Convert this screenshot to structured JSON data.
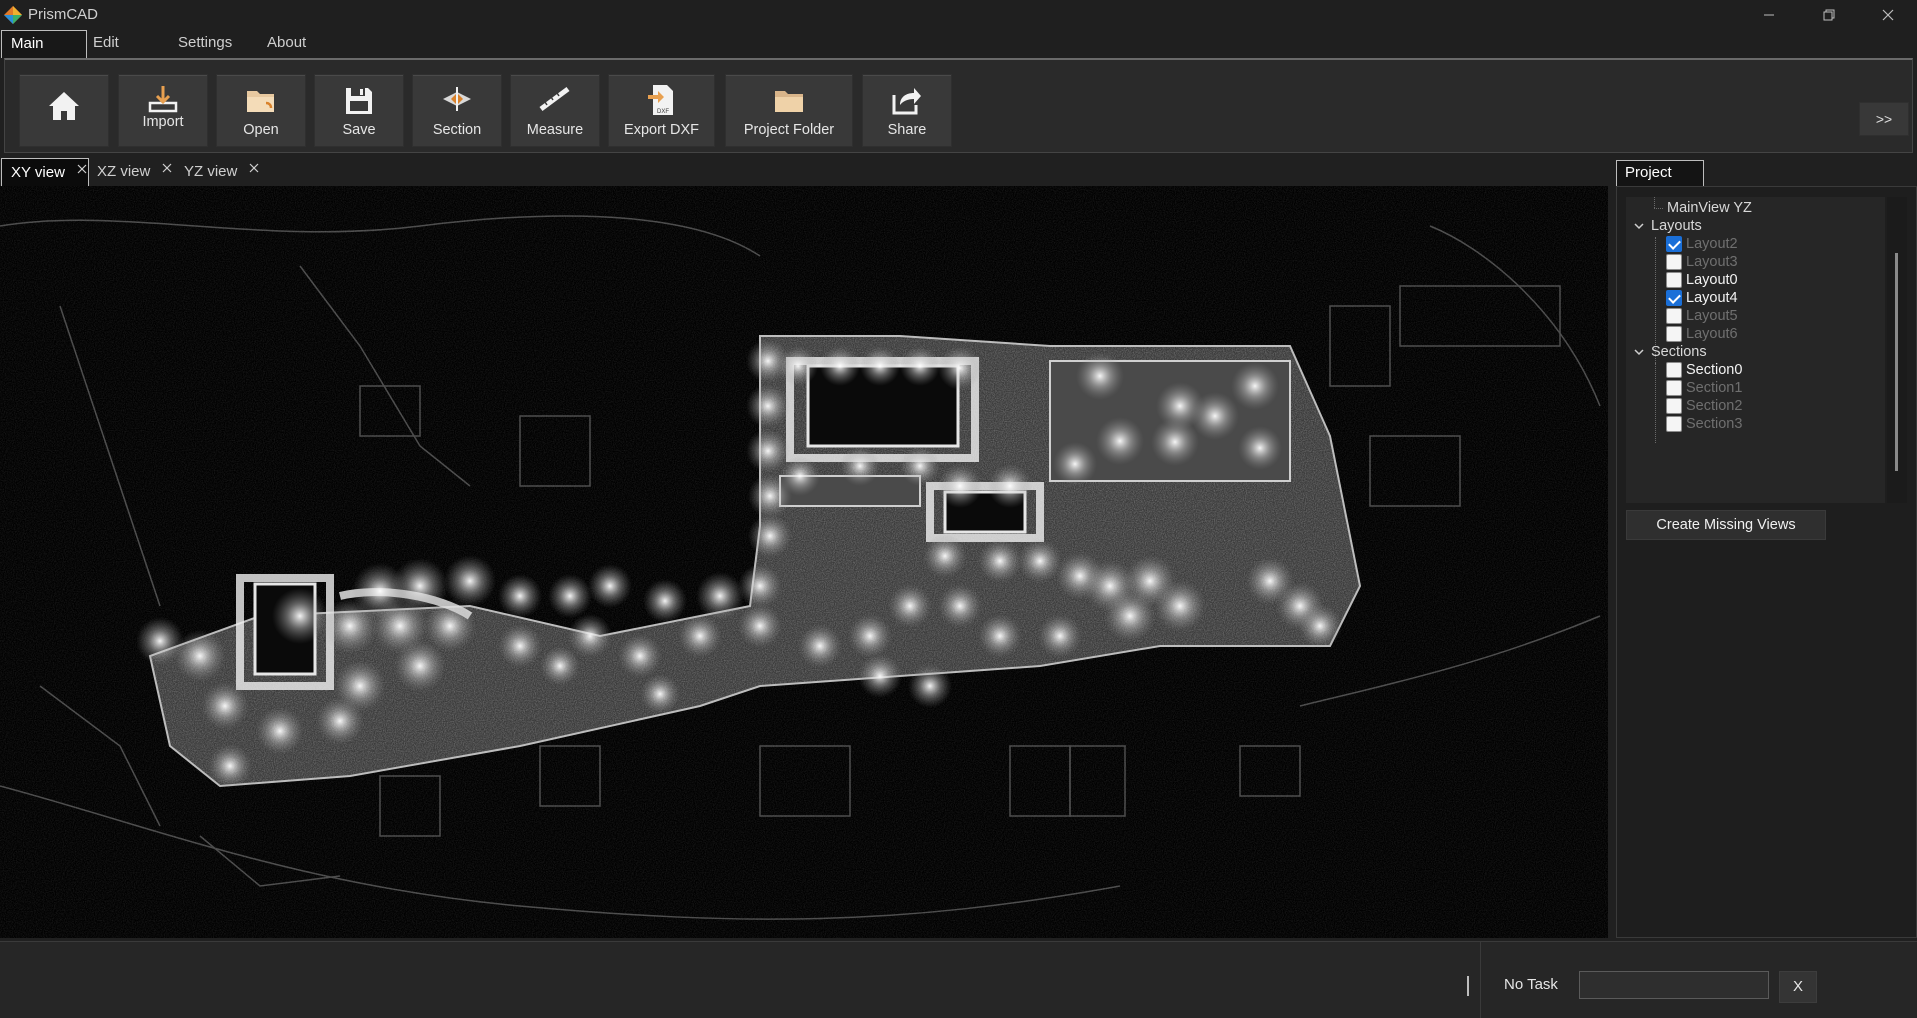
{
  "app": {
    "title": "PrismCAD",
    "logo_icon": "prismcad-logo-icon"
  },
  "window_controls": {
    "minimize": "minimize-icon",
    "restore": "restore-icon",
    "close": "close-icon"
  },
  "menu": {
    "tabs": [
      "Main",
      "Edit",
      "Settings",
      "About"
    ],
    "active": "Main"
  },
  "ribbon": {
    "buttons": [
      {
        "label": "",
        "icon": "home-icon"
      },
      {
        "label": "Import",
        "icon": "import-icon"
      },
      {
        "label": "Open",
        "icon": "folder-open-icon"
      },
      {
        "label": "Save",
        "icon": "save-icon"
      },
      {
        "label": "Section",
        "icon": "section-icon"
      },
      {
        "label": "Measure",
        "icon": "measure-icon"
      },
      {
        "label": "Export DXF",
        "icon": "export-dxf-icon",
        "badge": "DXF"
      },
      {
        "label": "Project Folder",
        "icon": "project-folder-icon"
      },
      {
        "label": "Share",
        "icon": "share-icon"
      }
    ],
    "more_label": ">>"
  },
  "view_tabs": {
    "tabs": [
      "XY view",
      "XZ view",
      "YZ view"
    ],
    "active": "XY view"
  },
  "project_panel": {
    "tab_label": "Project",
    "tree": {
      "top_item": "MainView YZ",
      "layouts_label": "Layouts",
      "layouts": [
        {
          "label": "Layout2",
          "checked": true,
          "dimmed": true
        },
        {
          "label": "Layout3",
          "checked": false,
          "dimmed": true
        },
        {
          "label": "Layout0",
          "checked": false,
          "dimmed": false
        },
        {
          "label": "Layout4",
          "checked": true,
          "dimmed": false
        },
        {
          "label": "Layout5",
          "checked": false,
          "dimmed": true
        },
        {
          "label": "Layout6",
          "checked": false,
          "dimmed": true
        }
      ],
      "sections_label": "Sections",
      "sections": [
        {
          "label": "Section0",
          "checked": false,
          "dimmed": false
        },
        {
          "label": "Section1",
          "checked": false,
          "dimmed": true
        },
        {
          "label": "Section2",
          "checked": false,
          "dimmed": true
        },
        {
          "label": "Section3",
          "checked": false,
          "dimmed": true
        }
      ]
    },
    "create_button": "Create Missing Views"
  },
  "status": {
    "task_label": "No Task",
    "task_value": "",
    "cancel_label": "X"
  },
  "colors": {
    "accent": "#1a6fd8",
    "background": "#202020",
    "viewport": "#000000"
  }
}
